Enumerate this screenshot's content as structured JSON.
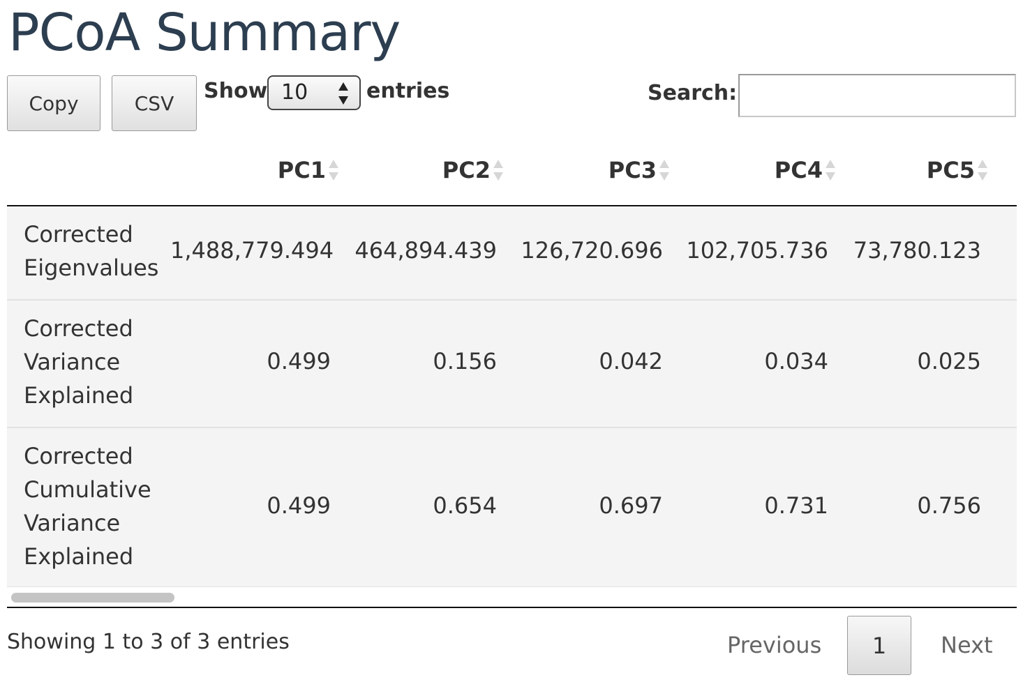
{
  "page": {
    "title": "PCoA Summary"
  },
  "toolbar": {
    "copy_label": "Copy",
    "csv_label": "CSV"
  },
  "length_menu": {
    "prefix": "Show",
    "selected": "10",
    "suffix": "entries"
  },
  "search": {
    "label": "Search:",
    "value": "",
    "placeholder": ""
  },
  "table": {
    "headers": [
      "",
      "PC1",
      "PC2",
      "PC3",
      "PC4",
      "PC5"
    ],
    "rows": [
      {
        "label_lines": [
          "Corrected",
          "Eigenvalues"
        ],
        "values": [
          "1,488,779.494",
          "464,894.439",
          "126,720.696",
          "102,705.736",
          "73,780.123"
        ]
      },
      {
        "label_lines": [
          "Corrected",
          "Variance",
          "Explained"
        ],
        "values": [
          "0.499",
          "0.156",
          "0.042",
          "0.034",
          "0.025"
        ]
      },
      {
        "label_lines": [
          "Corrected",
          "Cumulative",
          "Variance",
          "Explained"
        ],
        "values": [
          "0.499",
          "0.654",
          "0.697",
          "0.731",
          "0.756"
        ]
      }
    ]
  },
  "info": {
    "text": "Showing 1 to 3 of 3 entries"
  },
  "pagination": {
    "previous": "Previous",
    "current": "1",
    "next": "Next"
  }
}
